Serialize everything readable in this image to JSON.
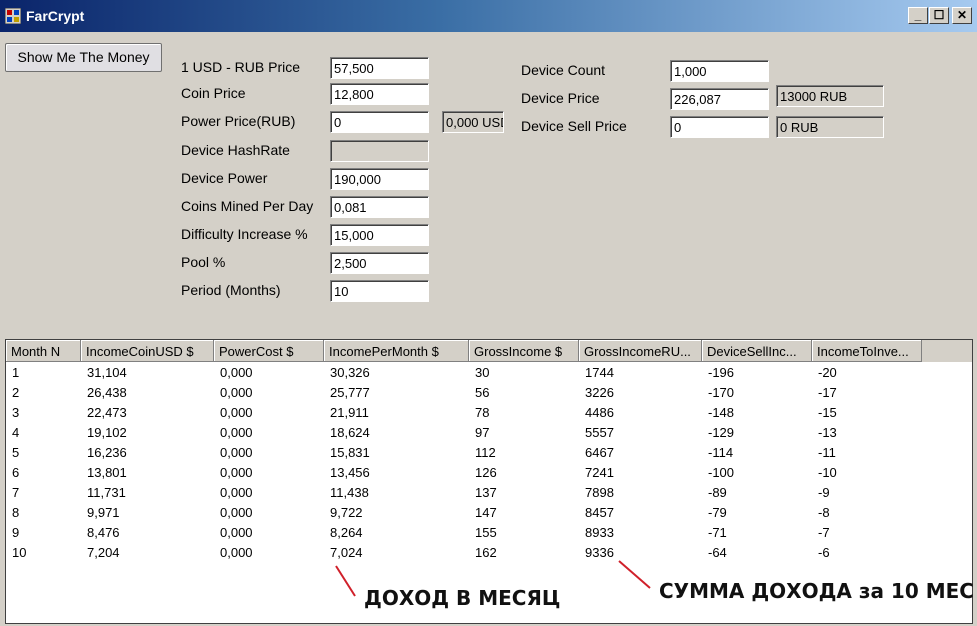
{
  "window": {
    "title": "FarCrypt"
  },
  "caption_buttons": {
    "minimize": "_",
    "maximize": "☐",
    "close": "✕"
  },
  "form": {
    "show_button": "Show Me The Money",
    "usd_rub_label": "1 USD - RUB Price",
    "usd_rub_value": "57,500",
    "coin_price_label": "Coin Price",
    "coin_price_value": "12,800",
    "power_price_label": "Power Price(RUB)",
    "power_price_value": "0",
    "power_price_usd": "0,000 USD",
    "hashrate_label": "Device HashRate",
    "hashrate_value": "",
    "device_power_label": "Device Power",
    "device_power_value": "190,000",
    "coins_mined_label": "Coins Mined Per Day",
    "coins_mined_value": "0,081",
    "difficulty_label": "Difficulty Increase %",
    "difficulty_value": "15,000",
    "pool_label": "Pool %",
    "pool_value": "2,500",
    "period_label": "Period (Months)",
    "period_value": "10",
    "device_count_label": "Device Count",
    "device_count_value": "1,000",
    "device_price_label": "Device Price",
    "device_price_value": "226,087",
    "device_price_rub": "13000 RUB",
    "device_sell_label": "Device Sell Price",
    "device_sell_value": "0",
    "device_sell_rub": "0 RUB"
  },
  "grid": {
    "columns": [
      "Month N",
      "IncomeCoinUSD $",
      "PowerCost $",
      "IncomePerMonth $",
      "GrossIncome $",
      "GrossIncomeRU...",
      "DeviceSellInc...",
      "IncomeToInve..."
    ],
    "rows": [
      [
        "1",
        "31,104",
        "0,000",
        "30,326",
        "30",
        "1744",
        "-196",
        "-20"
      ],
      [
        "2",
        "26,438",
        "0,000",
        "25,777",
        "56",
        "3226",
        "-170",
        "-17"
      ],
      [
        "3",
        "22,473",
        "0,000",
        "21,911",
        "78",
        "4486",
        "-148",
        "-15"
      ],
      [
        "4",
        "19,102",
        "0,000",
        "18,624",
        "97",
        "5557",
        "-129",
        "-13"
      ],
      [
        "5",
        "16,236",
        "0,000",
        "15,831",
        "112",
        "6467",
        "-114",
        "-11"
      ],
      [
        "6",
        "13,801",
        "0,000",
        "13,456",
        "126",
        "7241",
        "-100",
        "-10"
      ],
      [
        "7",
        "11,731",
        "0,000",
        "11,438",
        "137",
        "7898",
        "-89",
        "-9"
      ],
      [
        "8",
        "9,971",
        "0,000",
        "9,722",
        "147",
        "8457",
        "-79",
        "-8"
      ],
      [
        "9",
        "8,476",
        "0,000",
        "8,264",
        "155",
        "8933",
        "-71",
        "-7"
      ],
      [
        "10",
        "7,204",
        "0,000",
        "7,024",
        "162",
        "9336",
        "-64",
        "-6"
      ]
    ]
  },
  "annotations": {
    "income_per_month": "ДОХОД В МЕСЯЦ",
    "total_income": "СУММА ДОХОДА за 10 МЕС",
    "color": "#d0202a"
  }
}
